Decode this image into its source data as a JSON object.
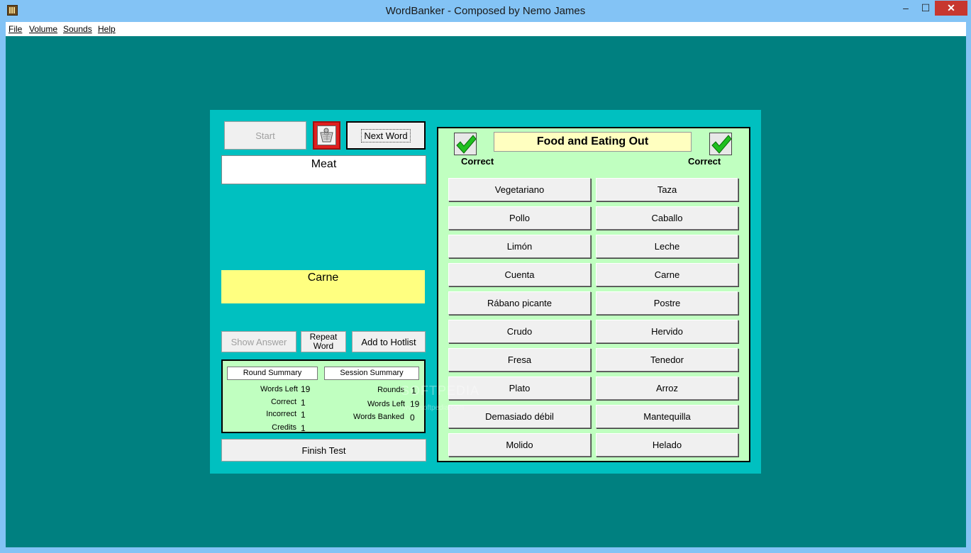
{
  "window": {
    "title": "WordBanker - Composed by Nemo James",
    "min": "–",
    "max": "☐",
    "close": "✕"
  },
  "menu": [
    "File",
    "Volume",
    "Sounds",
    "Help"
  ],
  "toolbar": {
    "start": "Start",
    "next_word": "Next Word"
  },
  "question_word": "Meat",
  "answer_word": "Carne",
  "actions": {
    "show_answer": "Show Answer",
    "repeat_word_1": "Repeat",
    "repeat_word_2": "Word",
    "add_hotlist": "Add to Hotlist",
    "finish_test": "Finish Test"
  },
  "round_summary": {
    "title": "Round Summary",
    "rows": [
      {
        "label": "Words Left",
        "value": "19"
      },
      {
        "label": "Correct",
        "value": "1"
      },
      {
        "label": "Incorrect",
        "value": "1"
      },
      {
        "label": "Credits",
        "value": "1"
      }
    ]
  },
  "session_summary": {
    "title": "Session Summary",
    "rows": [
      {
        "label": "Rounds",
        "value": "1"
      },
      {
        "label": "Words Left",
        "value": "19"
      },
      {
        "label": "Words Banked",
        "value": "0"
      }
    ]
  },
  "category": "Food and Eating Out",
  "correct_left": "Correct",
  "correct_right": "Correct",
  "choices_left": [
    "Vegetariano",
    "Pollo",
    "Limón",
    "Cuenta",
    "Rábano picante",
    "Crudo",
    "Fresa",
    "Plato",
    "Demasiado débil",
    "Molido"
  ],
  "choices_right": [
    "Taza",
    "Caballo",
    "Leche",
    "Carne",
    "Postre",
    "Hervido",
    "Tenedor",
    "Arroz",
    "Mantequilla",
    "Helado"
  ],
  "watermark": "SOFTPEDIA",
  "watermark_url": "www.softpedia.com",
  "colors": {
    "background": "#008080",
    "panel": "#00c0c0",
    "answer": "#ffff80",
    "summary": "#c0ffc0",
    "accent_red": "#e02020",
    "check_green": "#20c020"
  },
  "icons": {
    "app": "bookshelf-icon",
    "basket": "basket-icon",
    "check": "checkmark-icon"
  }
}
